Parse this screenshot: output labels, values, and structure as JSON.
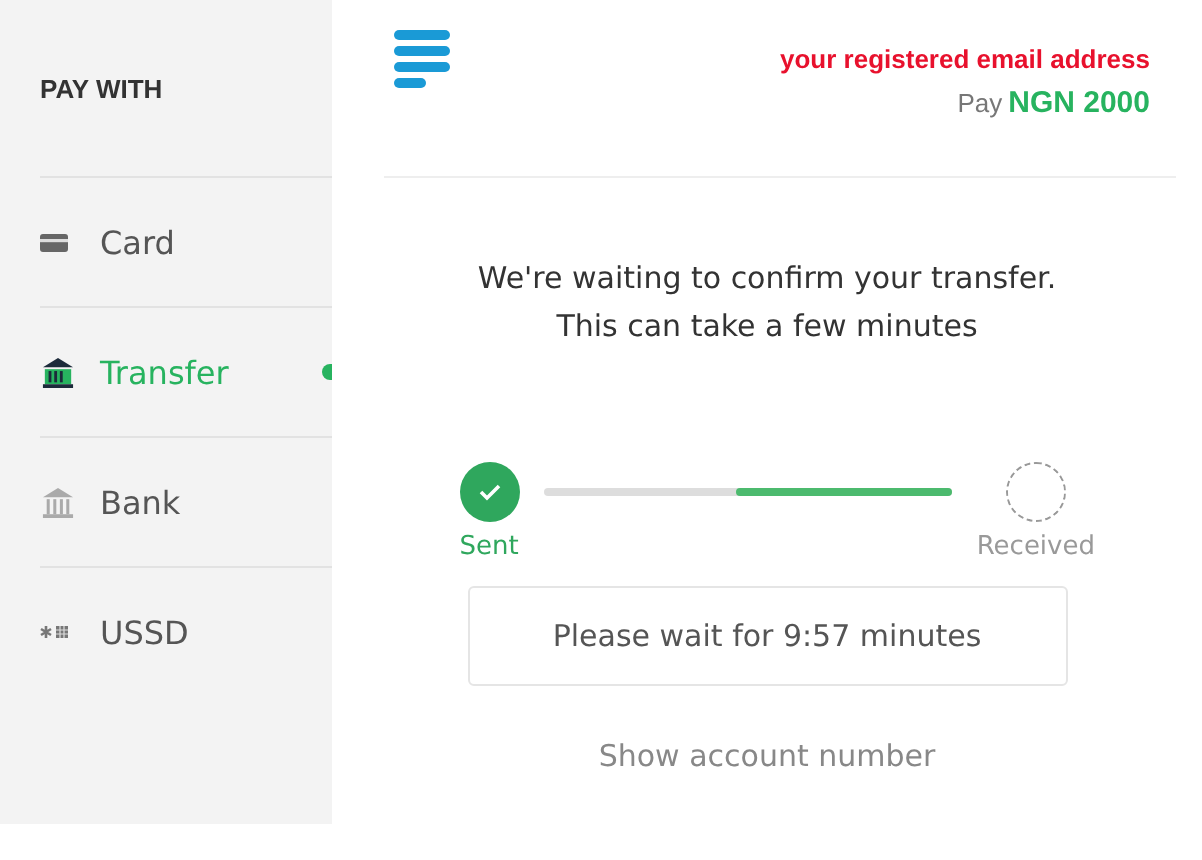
{
  "sidebar": {
    "heading": "PAY WITH",
    "items": [
      {
        "label": "Card",
        "kind": "card",
        "selected": false
      },
      {
        "label": "Transfer",
        "kind": "transfer",
        "selected": true
      },
      {
        "label": "Bank",
        "kind": "bank",
        "selected": false
      },
      {
        "label": "USSD",
        "kind": "ussd",
        "selected": false
      }
    ]
  },
  "header": {
    "email": "your registered email address",
    "pay_label": "Pay",
    "amount": "NGN 2000"
  },
  "message": [
    "We're waiting to confirm your transfer.",
    "This can take a few minutes"
  ],
  "progress": {
    "level": 0.53,
    "steps": [
      {
        "label": "Sent",
        "kind": "done"
      },
      {
        "label": "Received",
        "kind": "pending"
      }
    ]
  },
  "wait_notice": "Please wait for 9:57 minutes",
  "link": "Show account number"
}
